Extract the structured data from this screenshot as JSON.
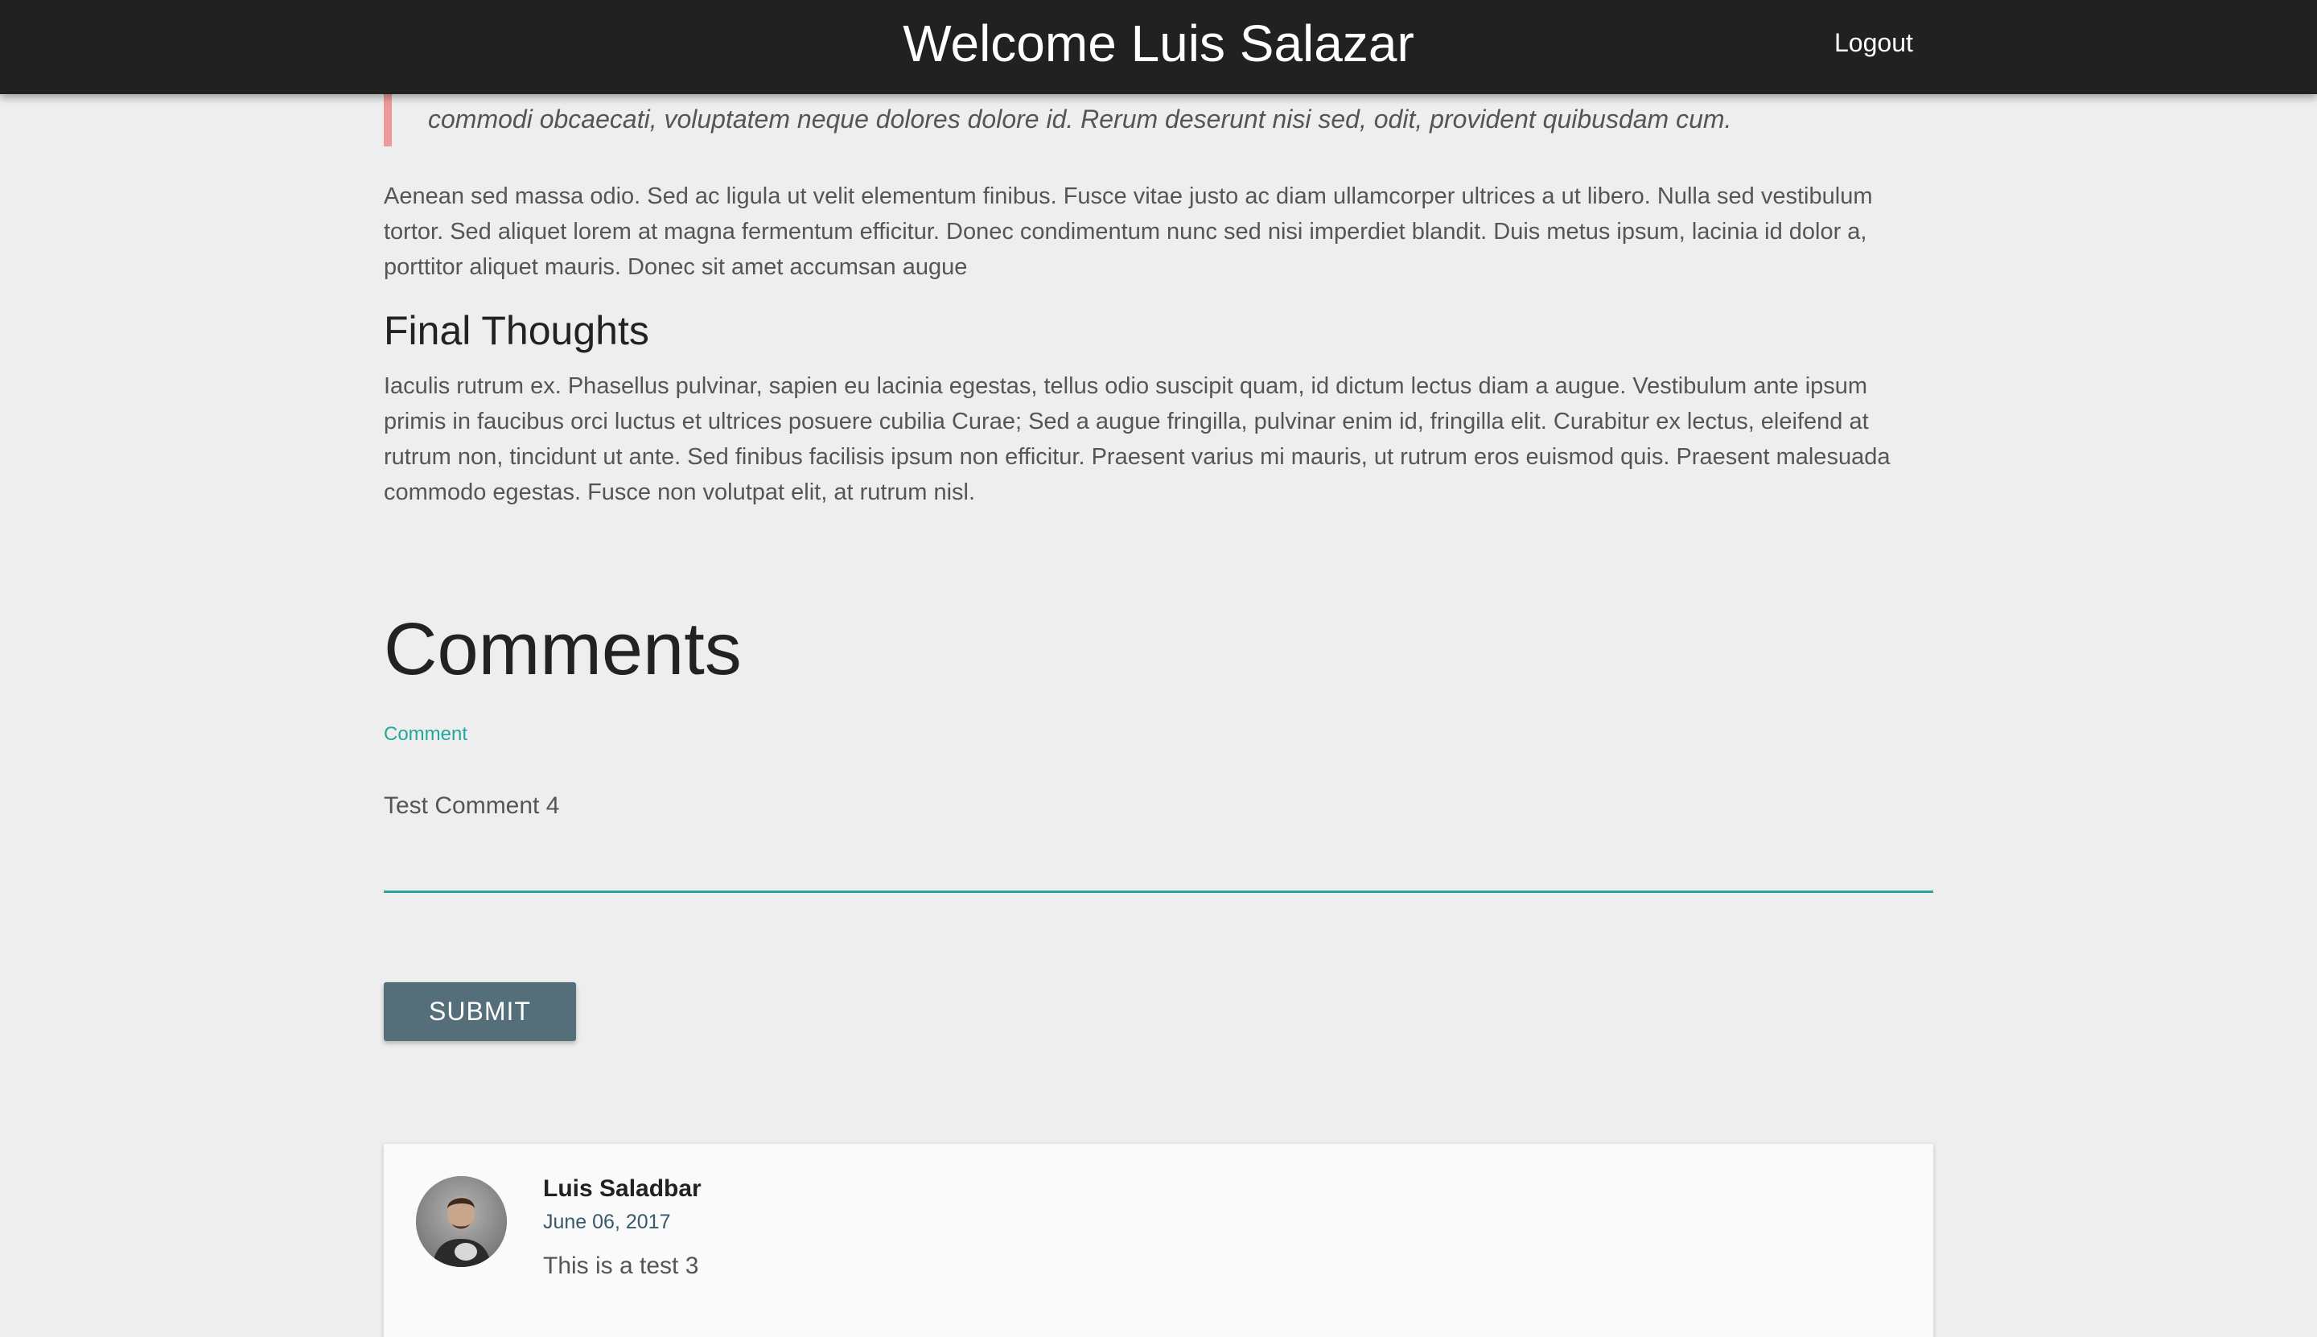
{
  "header": {
    "title": "Welcome Luis Salazar",
    "logout_label": "Logout"
  },
  "article": {
    "quote": "commodi obcaecati, voluptatem neque dolores dolore id. Rerum deserunt nisi sed, odit, provident quibusdam cum.",
    "paragraph1": "Aenean sed massa odio. Sed ac ligula ut velit elementum finibus. Fusce vitae justo ac diam ullamcorper ultrices a ut libero. Nulla sed vestibulum tortor. Sed aliquet lorem at magna fermentum efficitur. Donec condimentum nunc sed nisi imperdiet blandit. Duis metus ipsum, lacinia id dolor a, porttitor aliquet mauris. Donec sit amet accumsan augue",
    "section_heading": "Final Thoughts",
    "paragraph2": "Iaculis rutrum ex. Phasellus pulvinar, sapien eu lacinia egestas, tellus odio suscipit quam, id dictum lectus diam a augue. Vestibulum ante ipsum primis in faucibus orci luctus et ultrices posuere cubilia Curae; Sed a augue fringilla, pulvinar enim id, fringilla elit. Curabitur ex lectus, eleifend at rutrum non, tincidunt ut ante. Sed finibus facilisis ipsum non efficitur. Praesent varius mi mauris, ut rutrum eros euismod quis. Praesent malesuada commodo egestas. Fusce non volutpat elit, at rutrum nisl."
  },
  "comments": {
    "title": "Comments",
    "form": {
      "label": "Comment",
      "value": "Test Comment 4",
      "submit_label": "SUBMIT"
    },
    "items": [
      {
        "author": "Luis Saladbar",
        "date": "June 06, 2017",
        "text": "This is a test 3",
        "avatar_icon": "user-avatar-photo"
      }
    ]
  },
  "colors": {
    "topbar": "#212121",
    "accent": "#26a69a",
    "button": "#546e7a",
    "quote_border": "#ef9a9a",
    "background": "#eeeeee"
  }
}
